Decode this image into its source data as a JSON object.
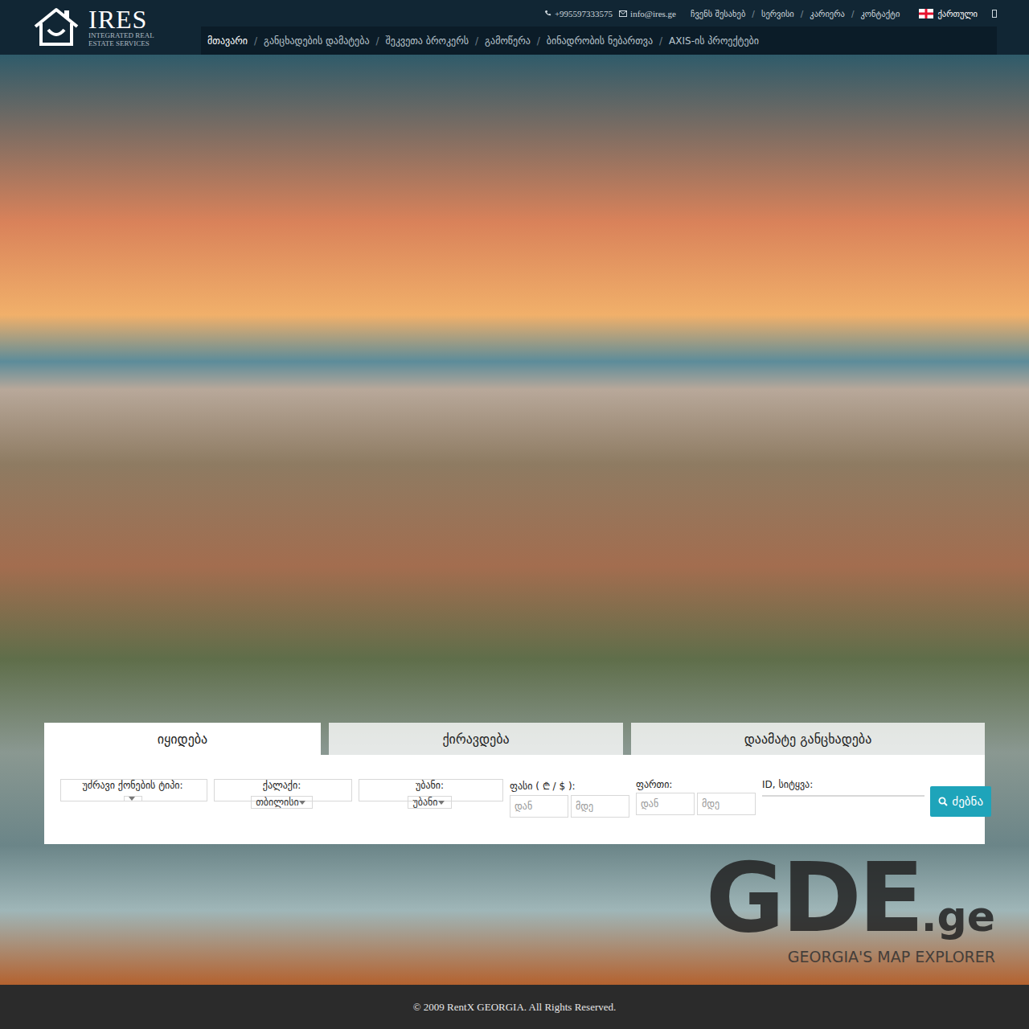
{
  "header": {
    "logo": {
      "title": "IRES",
      "subtitle": [
        "INTEGRATED REAL",
        "ESTATE SERVICES"
      ]
    },
    "contacts": [
      {
        "kind": "phone",
        "text": "+995597333575"
      },
      {
        "kind": "email",
        "text": "info@ires.ge"
      }
    ],
    "top_links": [
      "ჩვენს შესახებ",
      "სერვისი",
      "კარიერა",
      "კონტაქტი"
    ],
    "separator": "/",
    "language": {
      "label": "ქართული"
    },
    "nav": [
      {
        "label": "მთავარი",
        "selected": true
      },
      {
        "label": "განცხადების დამატება",
        "selected": false
      },
      {
        "label": "შეკვეთა ბროკერს",
        "selected": false
      },
      {
        "label": "გამოწერა",
        "selected": false
      },
      {
        "label": "ბინადრობის ნებართვა",
        "selected": false
      },
      {
        "label": "AXIS-ის პროექტები",
        "selected": false
      }
    ]
  },
  "search": {
    "tabs": [
      {
        "label": "იყიდება",
        "selected": true
      },
      {
        "label": "ქირავდება",
        "selected": false
      },
      {
        "label": "დაამატე განცხადება",
        "selected": false
      }
    ],
    "fields": [
      {
        "kind": "select",
        "label": "უძრავი ქონების ტიპი:",
        "value": ""
      },
      {
        "kind": "select",
        "label": "ქალაქი:",
        "value": "თბილისი"
      },
      {
        "kind": "select",
        "label": "უბანი:",
        "value": "უბანი"
      },
      {
        "kind": "range",
        "label": "ფასი ( ₾ / $ ):",
        "from": "დან",
        "to": "მდე"
      },
      {
        "kind": "range",
        "label": "ფართი:",
        "from": "დან",
        "to": "მდე"
      },
      {
        "kind": "text",
        "label": "ID, სიტყვა:",
        "value": ""
      }
    ],
    "button": {
      "label": "ძებნა"
    }
  },
  "watermark": {
    "title": "GDE",
    "suffix": ".ge",
    "tagline": "GEORGIA'S MAP EXPLORER"
  },
  "footer": {
    "text": "© 2009 RentX GEORGIA. All Rights Reserved."
  }
}
